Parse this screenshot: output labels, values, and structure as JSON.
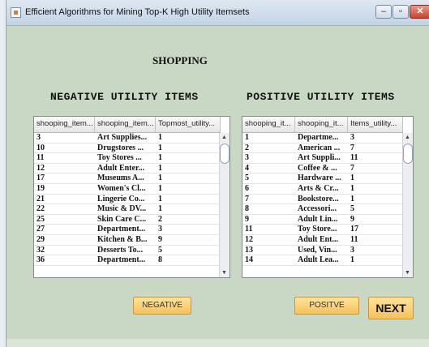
{
  "window": {
    "title": "Efficient Algorithms for Mining Top-K High Utility Itemsets",
    "min_glyph": "‒",
    "max_glyph": "▫",
    "close_glyph": "✕"
  },
  "heading": "SHOPPING",
  "negative": {
    "title": "NEGATIVE UTILITY ITEMS",
    "columns": [
      "shooping_item...",
      "shooping_item...",
      "Topmost_utility..."
    ],
    "rows": [
      [
        "3",
        "Art Supplies...",
        "1"
      ],
      [
        "10",
        "Drugstores ...",
        "1"
      ],
      [
        "11",
        "Toy Stores ...",
        "1"
      ],
      [
        "12",
        "Adult Enter...",
        "1"
      ],
      [
        "17",
        "Museums A...",
        "1"
      ],
      [
        "19",
        "Women's Cl...",
        "1"
      ],
      [
        "21",
        "Lingerie Co...",
        "1"
      ],
      [
        "22",
        "Music & DV...",
        "1"
      ],
      [
        "25",
        "Skin Care C...",
        "2"
      ],
      [
        "27",
        "Department...",
        "3"
      ],
      [
        "29",
        "Kitchen & B...",
        "9"
      ],
      [
        "32",
        "Desserts To...",
        "5"
      ],
      [
        "36",
        "Department...",
        "8"
      ]
    ]
  },
  "positive": {
    "title": "POSITIVE UTILITY ITEMS",
    "columns": [
      "shooping_it...",
      "shooping_it...",
      "Items_utility..."
    ],
    "rows": [
      [
        "1",
        "Departme...",
        "3"
      ],
      [
        "2",
        "American ...",
        "7"
      ],
      [
        "3",
        "Art Suppli...",
        "11"
      ],
      [
        "4",
        "Coffee & ...",
        "7"
      ],
      [
        "5",
        "Hardware ...",
        "1"
      ],
      [
        "6",
        "Arts & Cr...",
        "1"
      ],
      [
        "7",
        "Bookstore...",
        "1"
      ],
      [
        "8",
        "Accessori...",
        "5"
      ],
      [
        "9",
        "Adult Lin...",
        "9"
      ],
      [
        "11",
        "Toy Store...",
        "17"
      ],
      [
        "12",
        "Adult Ent...",
        "11"
      ],
      [
        "13",
        "Used, Vin...",
        "3"
      ],
      [
        "14",
        "Adult Lea...",
        "1"
      ]
    ]
  },
  "buttons": {
    "negative": "NEGATIVE",
    "positive": "POSITVE",
    "next": "NEXT"
  },
  "scroll": {
    "up": "▲",
    "down": "▼"
  }
}
